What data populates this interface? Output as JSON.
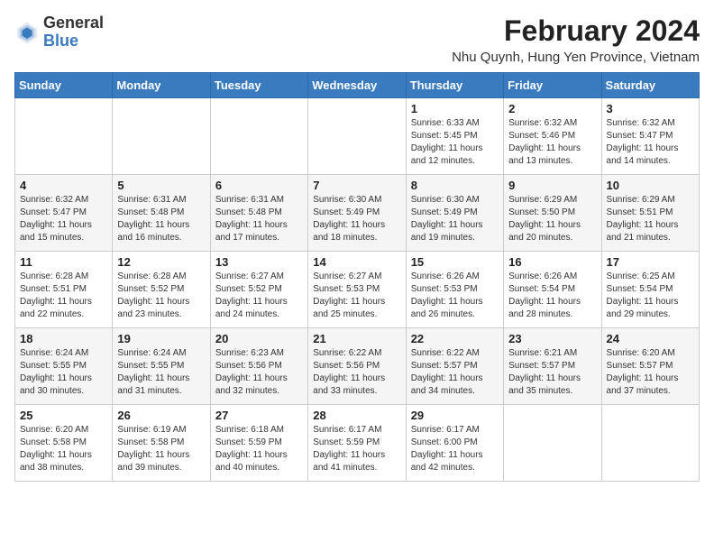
{
  "header": {
    "logo_general": "General",
    "logo_blue": "Blue",
    "month_year": "February 2024",
    "location": "Nhu Quynh, Hung Yen Province, Vietnam"
  },
  "days_of_week": [
    "Sunday",
    "Monday",
    "Tuesday",
    "Wednesday",
    "Thursday",
    "Friday",
    "Saturday"
  ],
  "weeks": [
    [
      {
        "day": "",
        "info": ""
      },
      {
        "day": "",
        "info": ""
      },
      {
        "day": "",
        "info": ""
      },
      {
        "day": "",
        "info": ""
      },
      {
        "day": "1",
        "info": "Sunrise: 6:33 AM\nSunset: 5:45 PM\nDaylight: 11 hours and 12 minutes."
      },
      {
        "day": "2",
        "info": "Sunrise: 6:32 AM\nSunset: 5:46 PM\nDaylight: 11 hours and 13 minutes."
      },
      {
        "day": "3",
        "info": "Sunrise: 6:32 AM\nSunset: 5:47 PM\nDaylight: 11 hours and 14 minutes."
      }
    ],
    [
      {
        "day": "4",
        "info": "Sunrise: 6:32 AM\nSunset: 5:47 PM\nDaylight: 11 hours and 15 minutes."
      },
      {
        "day": "5",
        "info": "Sunrise: 6:31 AM\nSunset: 5:48 PM\nDaylight: 11 hours and 16 minutes."
      },
      {
        "day": "6",
        "info": "Sunrise: 6:31 AM\nSunset: 5:48 PM\nDaylight: 11 hours and 17 minutes."
      },
      {
        "day": "7",
        "info": "Sunrise: 6:30 AM\nSunset: 5:49 PM\nDaylight: 11 hours and 18 minutes."
      },
      {
        "day": "8",
        "info": "Sunrise: 6:30 AM\nSunset: 5:49 PM\nDaylight: 11 hours and 19 minutes."
      },
      {
        "day": "9",
        "info": "Sunrise: 6:29 AM\nSunset: 5:50 PM\nDaylight: 11 hours and 20 minutes."
      },
      {
        "day": "10",
        "info": "Sunrise: 6:29 AM\nSunset: 5:51 PM\nDaylight: 11 hours and 21 minutes."
      }
    ],
    [
      {
        "day": "11",
        "info": "Sunrise: 6:28 AM\nSunset: 5:51 PM\nDaylight: 11 hours and 22 minutes."
      },
      {
        "day": "12",
        "info": "Sunrise: 6:28 AM\nSunset: 5:52 PM\nDaylight: 11 hours and 23 minutes."
      },
      {
        "day": "13",
        "info": "Sunrise: 6:27 AM\nSunset: 5:52 PM\nDaylight: 11 hours and 24 minutes."
      },
      {
        "day": "14",
        "info": "Sunrise: 6:27 AM\nSunset: 5:53 PM\nDaylight: 11 hours and 25 minutes."
      },
      {
        "day": "15",
        "info": "Sunrise: 6:26 AM\nSunset: 5:53 PM\nDaylight: 11 hours and 26 minutes."
      },
      {
        "day": "16",
        "info": "Sunrise: 6:26 AM\nSunset: 5:54 PM\nDaylight: 11 hours and 28 minutes."
      },
      {
        "day": "17",
        "info": "Sunrise: 6:25 AM\nSunset: 5:54 PM\nDaylight: 11 hours and 29 minutes."
      }
    ],
    [
      {
        "day": "18",
        "info": "Sunrise: 6:24 AM\nSunset: 5:55 PM\nDaylight: 11 hours and 30 minutes."
      },
      {
        "day": "19",
        "info": "Sunrise: 6:24 AM\nSunset: 5:55 PM\nDaylight: 11 hours and 31 minutes."
      },
      {
        "day": "20",
        "info": "Sunrise: 6:23 AM\nSunset: 5:56 PM\nDaylight: 11 hours and 32 minutes."
      },
      {
        "day": "21",
        "info": "Sunrise: 6:22 AM\nSunset: 5:56 PM\nDaylight: 11 hours and 33 minutes."
      },
      {
        "day": "22",
        "info": "Sunrise: 6:22 AM\nSunset: 5:57 PM\nDaylight: 11 hours and 34 minutes."
      },
      {
        "day": "23",
        "info": "Sunrise: 6:21 AM\nSunset: 5:57 PM\nDaylight: 11 hours and 35 minutes."
      },
      {
        "day": "24",
        "info": "Sunrise: 6:20 AM\nSunset: 5:57 PM\nDaylight: 11 hours and 37 minutes."
      }
    ],
    [
      {
        "day": "25",
        "info": "Sunrise: 6:20 AM\nSunset: 5:58 PM\nDaylight: 11 hours and 38 minutes."
      },
      {
        "day": "26",
        "info": "Sunrise: 6:19 AM\nSunset: 5:58 PM\nDaylight: 11 hours and 39 minutes."
      },
      {
        "day": "27",
        "info": "Sunrise: 6:18 AM\nSunset: 5:59 PM\nDaylight: 11 hours and 40 minutes."
      },
      {
        "day": "28",
        "info": "Sunrise: 6:17 AM\nSunset: 5:59 PM\nDaylight: 11 hours and 41 minutes."
      },
      {
        "day": "29",
        "info": "Sunrise: 6:17 AM\nSunset: 6:00 PM\nDaylight: 11 hours and 42 minutes."
      },
      {
        "day": "",
        "info": ""
      },
      {
        "day": "",
        "info": ""
      }
    ]
  ]
}
